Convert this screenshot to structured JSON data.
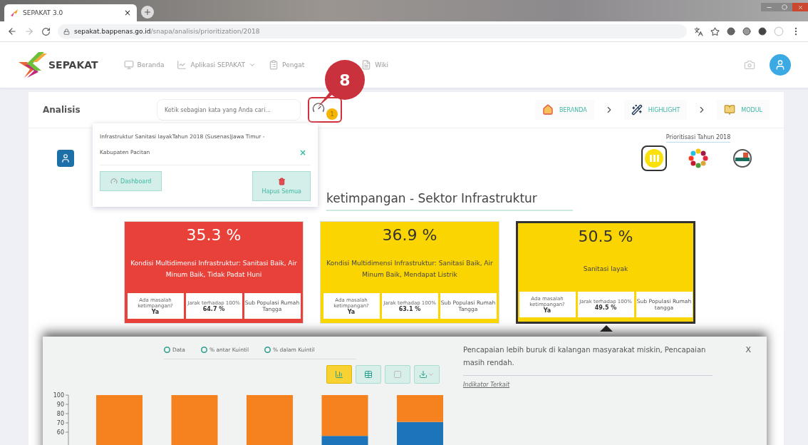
{
  "browser": {
    "tab_title": "SEPAKAT 3.0",
    "tab_close": "×",
    "url_host": "sepakat.bappenas.go.id",
    "url_path": "/snapa/analisis/prioritization/2018"
  },
  "header": {
    "brand": "SEPAKAT",
    "nav": [
      {
        "kind": "monitor",
        "label": "Beranda"
      },
      {
        "kind": "chart",
        "label": "Aplikasi SEPAKAT"
      },
      {
        "kind": "clipboard",
        "label": "Pengat"
      },
      {
        "kind": "file",
        "label": "Wiki"
      }
    ]
  },
  "toolbar": {
    "title": "Analisis",
    "search_placeholder": "Ketik sebagian kata yang Anda cari...",
    "badge": "1",
    "breadcrumbs": [
      {
        "kind": "home",
        "label": "BERANDA"
      },
      {
        "kind": "wand",
        "label": "HIGHLIGHT"
      },
      {
        "kind": "book",
        "label": "MODUL"
      }
    ]
  },
  "callout": {
    "number": "8"
  },
  "popup": {
    "text": "Infrastruktur Sanitasi layakTahun 2018 (Susenas)Jawa Timur - Kabupaten Pacitan",
    "close": "×",
    "buttons": [
      {
        "kind": "dashboard",
        "label": "Dashboard"
      },
      {
        "kind": "delete",
        "label": "Hapus Semua"
      }
    ]
  },
  "priority": {
    "label": "Prioritisasi Tahun 2018",
    "options": [
      {
        "kind": "yellow",
        "selected": true
      },
      {
        "kind": "wheel",
        "selected": false
      },
      {
        "kind": "globe",
        "selected": false
      }
    ]
  },
  "section_title": "ketimpangan - Sektor Infrastruktur",
  "cards": [
    {
      "value": "35.3 %",
      "label": "Kondisi Multidimensi Infrastruktur: Sanitasi Baik, Air Minum Baik, Tidak Padat Huni",
      "color": "#e8413a",
      "selected": false,
      "stats": [
        {
          "label": "Ada masalah ketimpangan?",
          "value": "Ya"
        },
        {
          "label": "Jarak terhadap 100%",
          "value": "64.7 %"
        },
        {
          "label": "Sub Populasi Rumah Tangga"
        }
      ]
    },
    {
      "value": "36.9 %",
      "label": "Kondisi Multidimensi Infrastruktur: Sanitasi Baik, Air Minum Baik, Mendapat Listrik",
      "color": "#fbd500",
      "selected": false,
      "stats": [
        {
          "label": "Ada masalah ketimpangan?",
          "value": "Ya"
        },
        {
          "label": "Jarak terhadap 100%",
          "value": "63.1 %"
        },
        {
          "label": "Sub Populasi Rumah Tangga"
        }
      ]
    },
    {
      "value": "50.5 %",
      "label": "Sanitasi layak",
      "color": "#fbd500",
      "selected": true,
      "stats": [
        {
          "label": "Ada masalah ketimpangan?",
          "value": "Ya"
        },
        {
          "label": "Jarak terhadap 100%",
          "value": "49.5 %"
        },
        {
          "label": "Sub Populasi Rumah tangga"
        }
      ]
    }
  ],
  "detail": {
    "options": [
      "Data",
      "% antar Kuintil",
      "% dalam Kuintil"
    ],
    "views": [
      {
        "kind": "chart",
        "selected": true
      },
      {
        "kind": "table",
        "selected": false
      },
      {
        "kind": "blank",
        "selected": false
      },
      {
        "kind": "download",
        "selected": false
      }
    ],
    "message": "Pencapaian lebih buruk di kalangan masyarakat miskin, Pencapaian masih rendah.",
    "close": "X",
    "link": "Indikator Terkait",
    "chart_data": {
      "type": "bar",
      "stacked": true,
      "ylim": [
        0,
        100
      ],
      "yticks": [
        60,
        70,
        80,
        90,
        100
      ],
      "series": [
        {
          "color": "#1c75b8",
          "values": [
            0,
            0,
            0,
            56,
            71
          ]
        },
        {
          "color": "#f5821f",
          "values": [
            100,
            100,
            100,
            44,
            29
          ]
        }
      ]
    }
  }
}
